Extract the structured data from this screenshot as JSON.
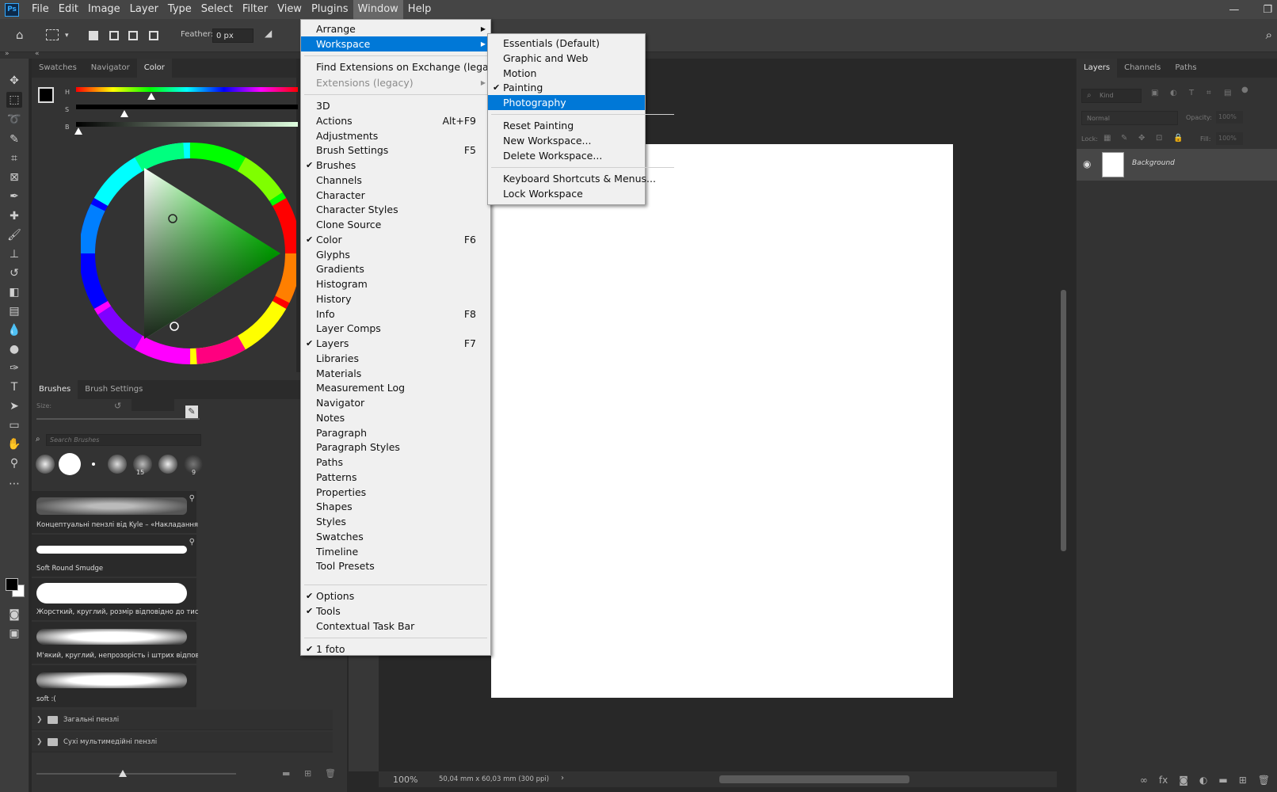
{
  "menubar": {
    "logo": "Ps",
    "items": [
      "File",
      "Edit",
      "Image",
      "Layer",
      "Type",
      "Select",
      "Filter",
      "View",
      "Plugins",
      "Window",
      "Help"
    ],
    "active_item": "Window"
  },
  "options_bar": {
    "feather_label": "Feather:",
    "feather_value": "0 px"
  },
  "color_panel": {
    "tabs": [
      "Swatches",
      "Navigator",
      "Color"
    ],
    "active_tab": "Color",
    "sliders": [
      "H",
      "S",
      "B"
    ]
  },
  "brushes_panel": {
    "tabs": [
      "Brushes",
      "Brush Settings"
    ],
    "active_tab": "Brushes",
    "size_label": "Size:",
    "search_placeholder": "Search Brushes",
    "tip_numbers": [
      "15",
      "9"
    ],
    "brushes": [
      "Концептуальні пензлі від Kyle – «Накладання ...",
      "Soft Round Smudge",
      "Жорсткий, круглий, розмір відповідно до тиску",
      "М'який, круглий, непрозорість і штрих відпові...",
      "soft :("
    ],
    "groups": [
      "Загальні пензлі",
      "Сухі мультимедійні пензлі"
    ]
  },
  "status_bar": {
    "zoom": "100%",
    "doc_size": "50,04 mm x 60,03 mm (300 ppi)"
  },
  "layers_panel": {
    "tabs": [
      "Layers",
      "Channels",
      "Paths"
    ],
    "active_tab": "Layers",
    "kind_placeholder": "Kind",
    "blend_mode": "Normal",
    "opacity_label": "Opacity:",
    "opacity_value": "100%",
    "lock_label": "Lock:",
    "fill_label": "Fill:",
    "fill_value": "100%",
    "layer_name": "Background"
  },
  "window_menu": {
    "items": [
      {
        "label": "Arrange",
        "submenu": true
      },
      {
        "label": "Workspace",
        "submenu": true,
        "highlighted": true
      },
      {
        "label": "Find Extensions on Exchange (legacy)..."
      },
      {
        "label": "Extensions (legacy)",
        "submenu": true,
        "disabled": true
      },
      {
        "label": "3D"
      },
      {
        "label": "Actions",
        "shortcut": "Alt+F9"
      },
      {
        "label": "Adjustments"
      },
      {
        "label": "Brush Settings",
        "shortcut": "F5"
      },
      {
        "label": "Brushes",
        "checked": true
      },
      {
        "label": "Channels"
      },
      {
        "label": "Character"
      },
      {
        "label": "Character Styles"
      },
      {
        "label": "Clone Source"
      },
      {
        "label": "Color",
        "checked": true,
        "shortcut": "F6"
      },
      {
        "label": "Glyphs"
      },
      {
        "label": "Gradients"
      },
      {
        "label": "Histogram"
      },
      {
        "label": "History"
      },
      {
        "label": "Info",
        "shortcut": "F8"
      },
      {
        "label": "Layer Comps"
      },
      {
        "label": "Layers",
        "checked": true,
        "shortcut": "F7"
      },
      {
        "label": "Libraries"
      },
      {
        "label": "Materials"
      },
      {
        "label": "Measurement Log"
      },
      {
        "label": "Navigator"
      },
      {
        "label": "Notes"
      },
      {
        "label": "Paragraph"
      },
      {
        "label": "Paragraph Styles"
      },
      {
        "label": "Paths"
      },
      {
        "label": "Patterns"
      },
      {
        "label": "Properties"
      },
      {
        "label": "Shapes"
      },
      {
        "label": "Styles"
      },
      {
        "label": "Swatches"
      },
      {
        "label": "Timeline"
      },
      {
        "label": "Tool Presets"
      },
      {
        "label": "Options",
        "checked": true
      },
      {
        "label": "Tools",
        "checked": true
      },
      {
        "label": "Contextual Task Bar"
      },
      {
        "label": "1 foto",
        "checked": true
      }
    ]
  },
  "workspace_menu": {
    "items": [
      {
        "label": "Essentials (Default)"
      },
      {
        "label": "Graphic and Web"
      },
      {
        "label": "Motion"
      },
      {
        "label": "Painting",
        "checked": true
      },
      {
        "label": "Photography",
        "highlighted": true
      },
      {
        "label": "Reset Painting"
      },
      {
        "label": "New Workspace..."
      },
      {
        "label": "Delete Workspace..."
      },
      {
        "label": "Keyboard Shortcuts & Menus..."
      },
      {
        "label": "Lock Workspace"
      }
    ]
  },
  "colors": {
    "menu_highlight": "#0078d7",
    "panel_bg": "#333333",
    "workspace_bg": "#282828"
  }
}
